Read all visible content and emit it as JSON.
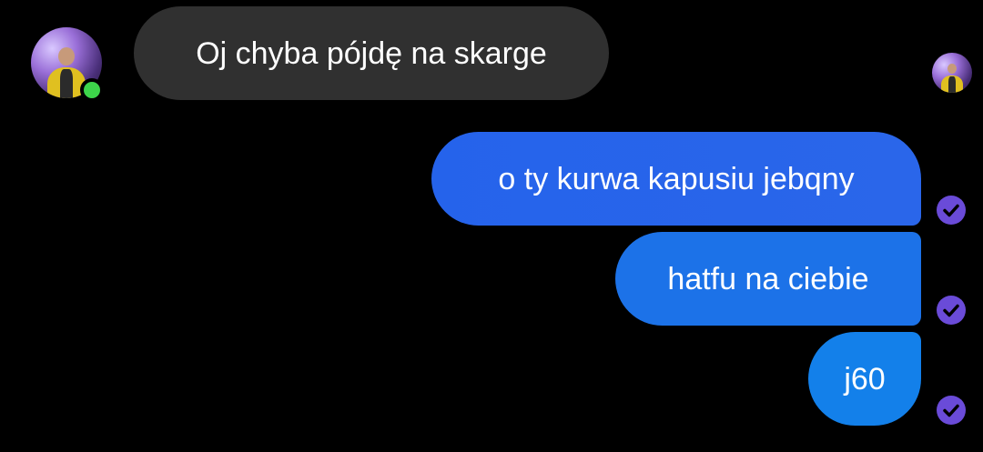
{
  "conversation": {
    "contact": {
      "avatar_icon": "contact-avatar-photo",
      "status": "online",
      "status_color": "#3dd54a"
    },
    "messages": [
      {
        "direction": "incoming",
        "text": "Oj chyba pójdę na skarge",
        "bubble_color": "#303030"
      },
      {
        "direction": "outgoing",
        "text": "o ty kurwa kapusiu jebqny",
        "bubble_color": "#2563eb",
        "status_icon": "delivered-check-icon"
      },
      {
        "direction": "outgoing",
        "text": "hatfu na ciebie",
        "bubble_color": "#1c72e8",
        "status_icon": "delivered-check-icon"
      },
      {
        "direction": "outgoing",
        "text": "j60",
        "bubble_color": "#1380ea",
        "status_icon": "delivered-check-icon"
      }
    ],
    "read_receipt_icon": "seen-avatar-icon",
    "check_color": "#6a4bd8",
    "background": "#000000"
  }
}
